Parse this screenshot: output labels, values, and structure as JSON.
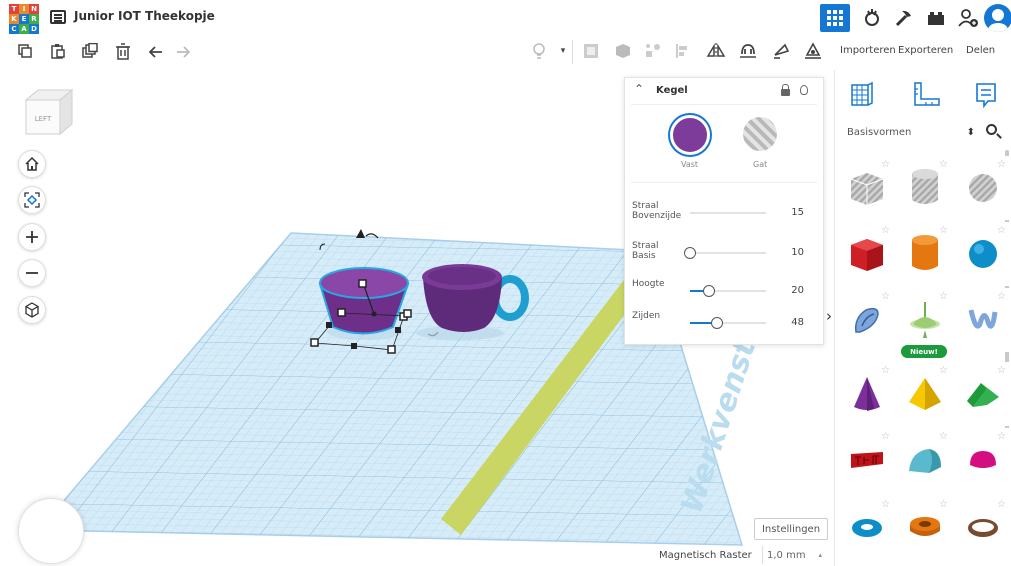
{
  "app": {
    "logo_letters": [
      "T",
      "I",
      "N",
      "K",
      "E",
      "R",
      "C",
      "A",
      "D"
    ],
    "project_title": "Junior IOT Theekopje",
    "colors": {
      "accent": "#1477d4",
      "solid_purple": "#7d3c9a",
      "workplane": "#cfe7f5",
      "arrow": "#cdd660"
    }
  },
  "topbar": {
    "icons": [
      "grid-view-icon",
      "tinker-icon",
      "build-icon",
      "brick-icon",
      "add-user-icon",
      "profile-avatar"
    ]
  },
  "toolbar": {
    "left_tools": [
      "copy-icon",
      "paste-icon",
      "duplicate-icon",
      "delete-icon",
      "undo-icon",
      "redo-icon"
    ],
    "right_tools": [
      "light-icon",
      "dropdown-icon",
      "note-icon",
      "hide-icon",
      "group-icon",
      "ungroup-icon",
      "align-icon",
      "mirror-icon",
      "cruise-icon",
      "ruler-icon",
      "workplane-icon"
    ],
    "import_label": "Importeren",
    "export_label": "Exporteren",
    "share_label": "Delen"
  },
  "viewcube": {
    "face_label": "LEFT"
  },
  "inspector": {
    "title": "Kegel",
    "solid_label": "Vast",
    "hole_label": "Gat",
    "params": [
      {
        "label": "Straal Bovenzijde",
        "value": "15",
        "fraction": 0.0
      },
      {
        "label": "Straal Basis",
        "value": "10",
        "fraction": 0.0
      },
      {
        "label": "Hoogte",
        "value": "20",
        "fraction": 0.25
      },
      {
        "label": "Zijden",
        "value": "48",
        "fraction": 0.35
      }
    ]
  },
  "workplane": {
    "watermark": "Werkvenster",
    "settings_label": "Instellingen",
    "snap_label": "Magnetisch Raster",
    "snap_value": "1,0 mm"
  },
  "library": {
    "selected": "Basisvormen",
    "new_badge": "Nieuw!",
    "shapes": [
      "transparent-box",
      "transparent-cylinder",
      "transparent-sphere",
      "box",
      "cylinder",
      "sphere",
      "scribble",
      "spinner",
      "text-shape",
      "cone",
      "pyramid",
      "roof",
      "text",
      "half-round-roof",
      "hemisphere",
      "torus",
      "tube",
      "ring"
    ]
  }
}
